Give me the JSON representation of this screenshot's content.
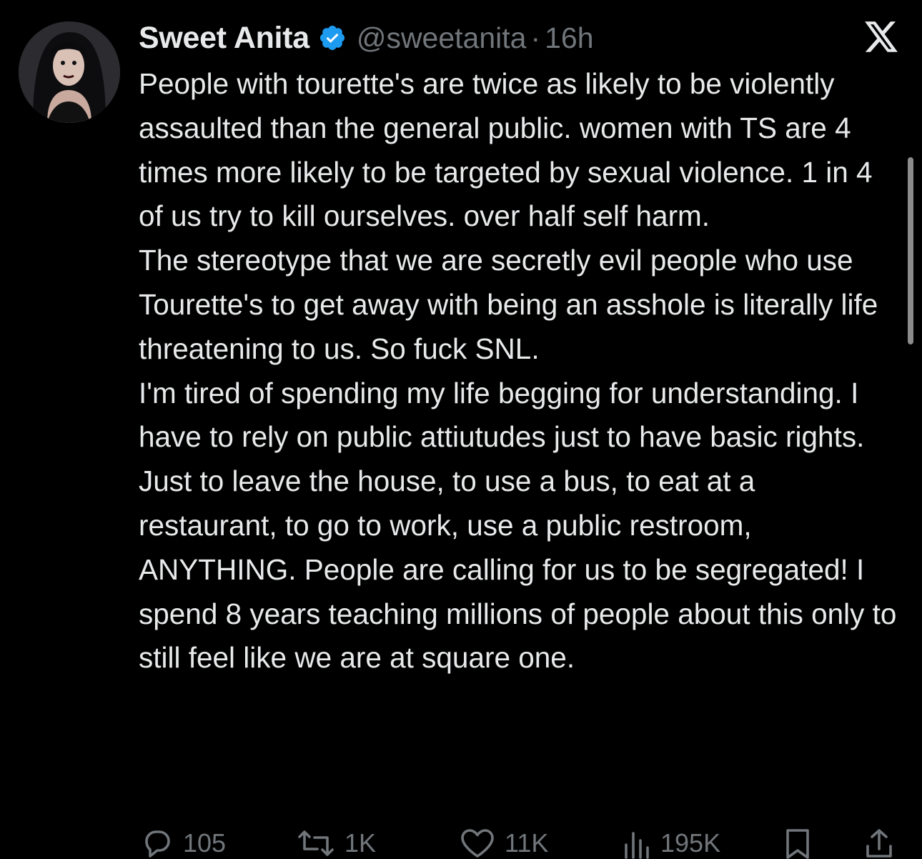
{
  "tweet": {
    "author": {
      "display_name": "Sweet Anita",
      "handle": "@sweetanita",
      "verified": true
    },
    "separator": "·",
    "time": "16h",
    "paragraphs": [
      "People with tourette's are twice as likely to be violently assaulted than the general public. women with TS are 4 times more likely to be targeted by sexual violence. 1 in 4 of us try to kill ourselves. over half self harm.",
      "The stereotype that we are secretly evil people who use Tourette's to get away with being an asshole is literally life threatening to us. So fuck SNL.",
      "I'm tired of spending my life begging for understanding. I have to rely on public attiutudes just to have basic rights. Just to leave the house, to use a bus, to eat at a restaurant, to go to work, use a public restroom, ANYTHING. People are calling for us to be segregated! I spend 8 years teaching millions of people about this only to still feel like we are at square one."
    ],
    "actions": {
      "replies": "105",
      "reposts": "1K",
      "likes": "11K",
      "views": "195K"
    }
  },
  "icons": {
    "verified": "verified-badge-icon",
    "brand": "x-logo-icon",
    "reply": "reply-icon",
    "repost": "repost-icon",
    "like": "heart-icon",
    "views": "views-icon",
    "bookmark": "bookmark-icon",
    "share": "share-icon"
  },
  "colors": {
    "background": "#000000",
    "text": "#e7e9ea",
    "secondary": "#71767b",
    "verified": "#1d9bf0"
  }
}
